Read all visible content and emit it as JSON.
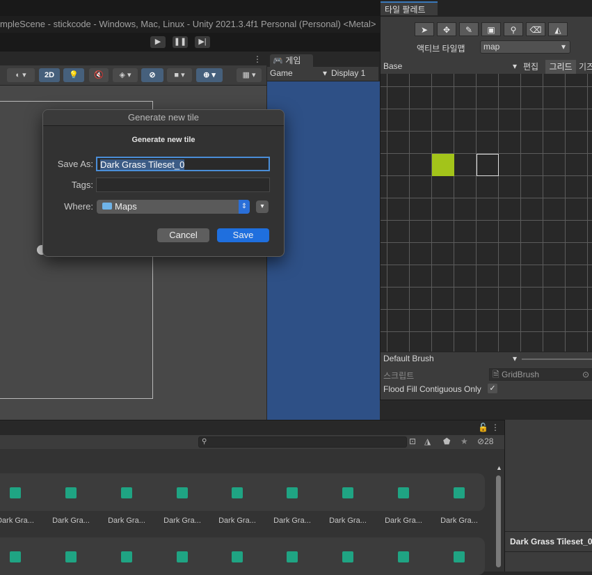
{
  "window": {
    "title": "mpleScene - stickcode - Windows, Mac, Linux - Unity 2021.3.4f1 Personal (Personal) <Metal>"
  },
  "playbar": {
    "play": "▶",
    "pause": "❚❚",
    "step": "▶|"
  },
  "scene_toolbar": {
    "mode_2d": "2D"
  },
  "game": {
    "tab_label": "게임",
    "view_dropdown": "Game",
    "display_dropdown": "Display 1"
  },
  "dialog": {
    "window_title": "Generate new tile",
    "heading": "Generate new tile",
    "save_as_label": "Save As:",
    "save_as_value": "Dark Grass Tileset_0",
    "tags_label": "Tags:",
    "tags_value": "",
    "where_label": "Where:",
    "where_value": "Maps",
    "cancel_label": "Cancel",
    "save_label": "Save"
  },
  "palette": {
    "tab_label": "타일 팔레트",
    "active_tilemap_label": "액티브 타일맵",
    "active_tilemap_value": "map",
    "palette_dropdown": "Base",
    "edit_label": "편집",
    "grid_label": "그리드",
    "gizmo_label": "기즈",
    "brush_dropdown": "Default Brush",
    "script_label": "스크립트",
    "script_value": "GridBrush",
    "flood_fill_label": "Flood Fill Contiguous Only",
    "flood_fill_checked": true,
    "tile_color": "#a3c41a"
  },
  "project": {
    "hidden_count": "28",
    "asset_labels": [
      "Dark Gra...",
      "Dark Gra...",
      "Dark Gra...",
      "Dark Gra...",
      "Dark Gra...",
      "Dark Gra...",
      "Dark Gra...",
      "Dark Gra...",
      "Dark Gra..."
    ]
  },
  "inspector": {
    "title": "Dark Grass Tileset_0"
  },
  "colors": {
    "accent": "#1f6fde",
    "game_background": "#2e5086",
    "asset_teal": "#1fa483"
  }
}
